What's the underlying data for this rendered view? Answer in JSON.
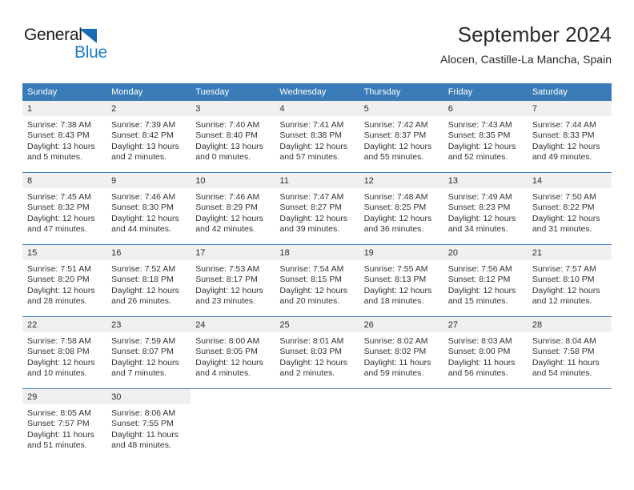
{
  "brand": {
    "word1": "General",
    "word2": "Blue",
    "triangle_color": "#1b6cb3",
    "word2_color": "#1b7ec4"
  },
  "header": {
    "title": "September 2024",
    "subtitle": "Alocen, Castille-La Mancha, Spain"
  },
  "theme": {
    "header_blue": "#3a7cb8",
    "day_band_gray": "#f0f0f0",
    "text": "#333333"
  },
  "calendar": {
    "weekdays": [
      "Sunday",
      "Monday",
      "Tuesday",
      "Wednesday",
      "Thursday",
      "Friday",
      "Saturday"
    ],
    "weeks": [
      [
        {
          "day": "1",
          "sunrise": "Sunrise: 7:38 AM",
          "sunset": "Sunset: 8:43 PM",
          "daylight1": "Daylight: 13 hours",
          "daylight2": "and 5 minutes."
        },
        {
          "day": "2",
          "sunrise": "Sunrise: 7:39 AM",
          "sunset": "Sunset: 8:42 PM",
          "daylight1": "Daylight: 13 hours",
          "daylight2": "and 2 minutes."
        },
        {
          "day": "3",
          "sunrise": "Sunrise: 7:40 AM",
          "sunset": "Sunset: 8:40 PM",
          "daylight1": "Daylight: 13 hours",
          "daylight2": "and 0 minutes."
        },
        {
          "day": "4",
          "sunrise": "Sunrise: 7:41 AM",
          "sunset": "Sunset: 8:38 PM",
          "daylight1": "Daylight: 12 hours",
          "daylight2": "and 57 minutes."
        },
        {
          "day": "5",
          "sunrise": "Sunrise: 7:42 AM",
          "sunset": "Sunset: 8:37 PM",
          "daylight1": "Daylight: 12 hours",
          "daylight2": "and 55 minutes."
        },
        {
          "day": "6",
          "sunrise": "Sunrise: 7:43 AM",
          "sunset": "Sunset: 8:35 PM",
          "daylight1": "Daylight: 12 hours",
          "daylight2": "and 52 minutes."
        },
        {
          "day": "7",
          "sunrise": "Sunrise: 7:44 AM",
          "sunset": "Sunset: 8:33 PM",
          "daylight1": "Daylight: 12 hours",
          "daylight2": "and 49 minutes."
        }
      ],
      [
        {
          "day": "8",
          "sunrise": "Sunrise: 7:45 AM",
          "sunset": "Sunset: 8:32 PM",
          "daylight1": "Daylight: 12 hours",
          "daylight2": "and 47 minutes."
        },
        {
          "day": "9",
          "sunrise": "Sunrise: 7:46 AM",
          "sunset": "Sunset: 8:30 PM",
          "daylight1": "Daylight: 12 hours",
          "daylight2": "and 44 minutes."
        },
        {
          "day": "10",
          "sunrise": "Sunrise: 7:46 AM",
          "sunset": "Sunset: 8:29 PM",
          "daylight1": "Daylight: 12 hours",
          "daylight2": "and 42 minutes."
        },
        {
          "day": "11",
          "sunrise": "Sunrise: 7:47 AM",
          "sunset": "Sunset: 8:27 PM",
          "daylight1": "Daylight: 12 hours",
          "daylight2": "and 39 minutes."
        },
        {
          "day": "12",
          "sunrise": "Sunrise: 7:48 AM",
          "sunset": "Sunset: 8:25 PM",
          "daylight1": "Daylight: 12 hours",
          "daylight2": "and 36 minutes."
        },
        {
          "day": "13",
          "sunrise": "Sunrise: 7:49 AM",
          "sunset": "Sunset: 8:23 PM",
          "daylight1": "Daylight: 12 hours",
          "daylight2": "and 34 minutes."
        },
        {
          "day": "14",
          "sunrise": "Sunrise: 7:50 AM",
          "sunset": "Sunset: 8:22 PM",
          "daylight1": "Daylight: 12 hours",
          "daylight2": "and 31 minutes."
        }
      ],
      [
        {
          "day": "15",
          "sunrise": "Sunrise: 7:51 AM",
          "sunset": "Sunset: 8:20 PM",
          "daylight1": "Daylight: 12 hours",
          "daylight2": "and 28 minutes."
        },
        {
          "day": "16",
          "sunrise": "Sunrise: 7:52 AM",
          "sunset": "Sunset: 8:18 PM",
          "daylight1": "Daylight: 12 hours",
          "daylight2": "and 26 minutes."
        },
        {
          "day": "17",
          "sunrise": "Sunrise: 7:53 AM",
          "sunset": "Sunset: 8:17 PM",
          "daylight1": "Daylight: 12 hours",
          "daylight2": "and 23 minutes."
        },
        {
          "day": "18",
          "sunrise": "Sunrise: 7:54 AM",
          "sunset": "Sunset: 8:15 PM",
          "daylight1": "Daylight: 12 hours",
          "daylight2": "and 20 minutes."
        },
        {
          "day": "19",
          "sunrise": "Sunrise: 7:55 AM",
          "sunset": "Sunset: 8:13 PM",
          "daylight1": "Daylight: 12 hours",
          "daylight2": "and 18 minutes."
        },
        {
          "day": "20",
          "sunrise": "Sunrise: 7:56 AM",
          "sunset": "Sunset: 8:12 PM",
          "daylight1": "Daylight: 12 hours",
          "daylight2": "and 15 minutes."
        },
        {
          "day": "21",
          "sunrise": "Sunrise: 7:57 AM",
          "sunset": "Sunset: 8:10 PM",
          "daylight1": "Daylight: 12 hours",
          "daylight2": "and 12 minutes."
        }
      ],
      [
        {
          "day": "22",
          "sunrise": "Sunrise: 7:58 AM",
          "sunset": "Sunset: 8:08 PM",
          "daylight1": "Daylight: 12 hours",
          "daylight2": "and 10 minutes."
        },
        {
          "day": "23",
          "sunrise": "Sunrise: 7:59 AM",
          "sunset": "Sunset: 8:07 PM",
          "daylight1": "Daylight: 12 hours",
          "daylight2": "and 7 minutes."
        },
        {
          "day": "24",
          "sunrise": "Sunrise: 8:00 AM",
          "sunset": "Sunset: 8:05 PM",
          "daylight1": "Daylight: 12 hours",
          "daylight2": "and 4 minutes."
        },
        {
          "day": "25",
          "sunrise": "Sunrise: 8:01 AM",
          "sunset": "Sunset: 8:03 PM",
          "daylight1": "Daylight: 12 hours",
          "daylight2": "and 2 minutes."
        },
        {
          "day": "26",
          "sunrise": "Sunrise: 8:02 AM",
          "sunset": "Sunset: 8:02 PM",
          "daylight1": "Daylight: 11 hours",
          "daylight2": "and 59 minutes."
        },
        {
          "day": "27",
          "sunrise": "Sunrise: 8:03 AM",
          "sunset": "Sunset: 8:00 PM",
          "daylight1": "Daylight: 11 hours",
          "daylight2": "and 56 minutes."
        },
        {
          "day": "28",
          "sunrise": "Sunrise: 8:04 AM",
          "sunset": "Sunset: 7:58 PM",
          "daylight1": "Daylight: 11 hours",
          "daylight2": "and 54 minutes."
        }
      ],
      [
        {
          "day": "29",
          "sunrise": "Sunrise: 8:05 AM",
          "sunset": "Sunset: 7:57 PM",
          "daylight1": "Daylight: 11 hours",
          "daylight2": "and 51 minutes."
        },
        {
          "day": "30",
          "sunrise": "Sunrise: 8:06 AM",
          "sunset": "Sunset: 7:55 PM",
          "daylight1": "Daylight: 11 hours",
          "daylight2": "and 48 minutes."
        },
        {
          "day": "",
          "sunrise": "",
          "sunset": "",
          "daylight1": "",
          "daylight2": ""
        },
        {
          "day": "",
          "sunrise": "",
          "sunset": "",
          "daylight1": "",
          "daylight2": ""
        },
        {
          "day": "",
          "sunrise": "",
          "sunset": "",
          "daylight1": "",
          "daylight2": ""
        },
        {
          "day": "",
          "sunrise": "",
          "sunset": "",
          "daylight1": "",
          "daylight2": ""
        },
        {
          "day": "",
          "sunrise": "",
          "sunset": "",
          "daylight1": "",
          "daylight2": ""
        }
      ]
    ]
  }
}
